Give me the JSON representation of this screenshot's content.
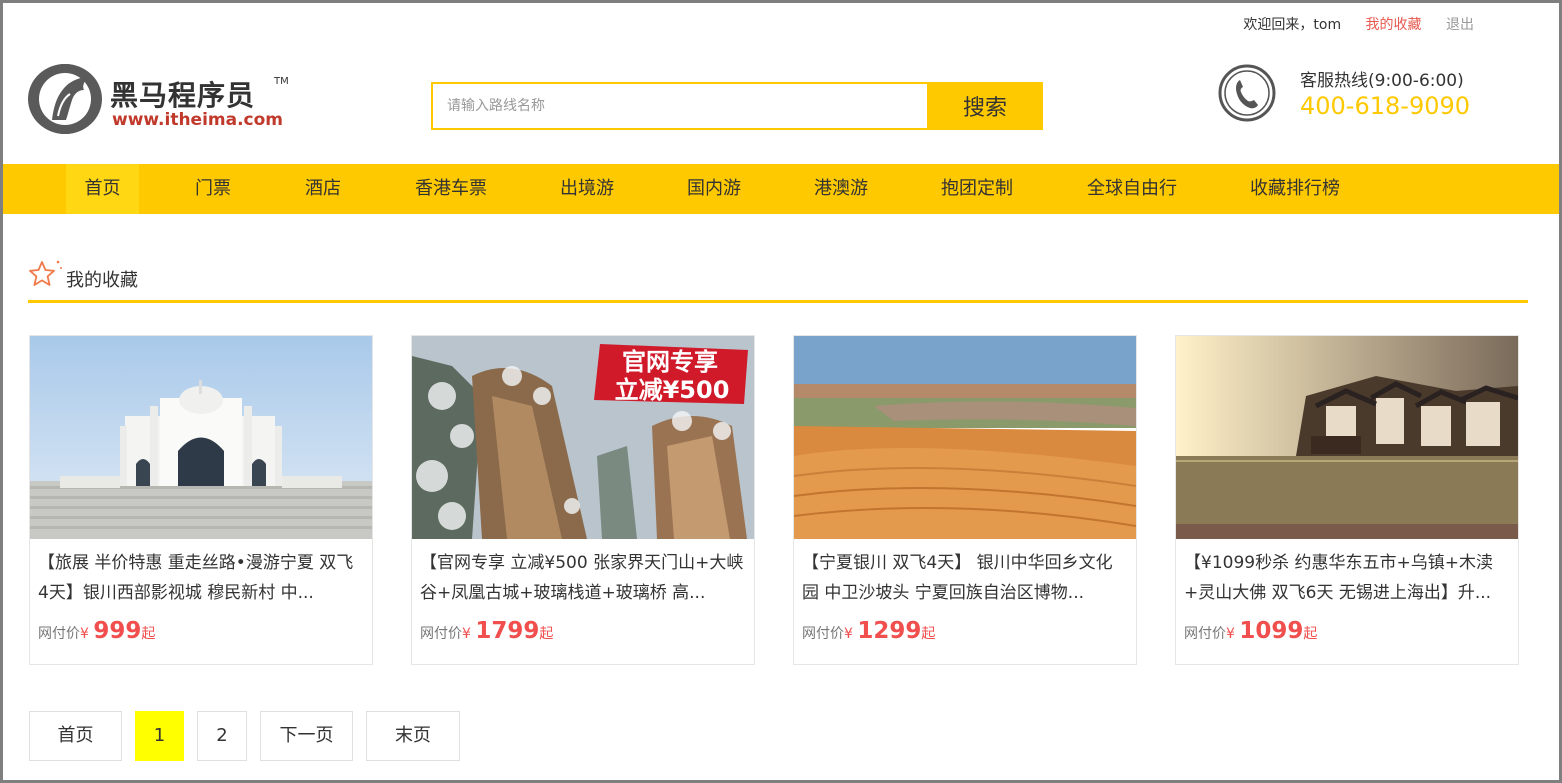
{
  "topbar": {
    "welcome": "欢迎回来，tom",
    "favorites": "我的收藏",
    "logout": "退出"
  },
  "logo": {
    "name": "黑马程序员",
    "tm": "TM",
    "url": "www.itheima.com"
  },
  "search": {
    "placeholder": "请输入路线名称",
    "button": "搜索"
  },
  "hotline": {
    "label": "客服热线(9:00-6:00)",
    "number": "400-618-9090"
  },
  "nav": {
    "items": [
      {
        "label": "首页",
        "active": true
      },
      {
        "label": "门票"
      },
      {
        "label": "酒店"
      },
      {
        "label": "香港车票"
      },
      {
        "label": "出境游"
      },
      {
        "label": "国内游"
      },
      {
        "label": "港澳游"
      },
      {
        "label": "抱团定制"
      },
      {
        "label": "全球自由行"
      },
      {
        "label": "收藏排行榜"
      }
    ]
  },
  "section": {
    "title": "我的收藏"
  },
  "cards": [
    {
      "title": "【旅展 半价特惠 重走丝路•漫游宁夏 双飞4天】银川西部影视城 穆民新村 中...",
      "price_label": "网付价",
      "currency": "¥",
      "price": "999",
      "suffix": "起"
    },
    {
      "title": "【官网专享 立减¥500 张家界天门山+大峡谷+凤凰古城+玻璃栈道+玻璃桥 高...",
      "price_label": "网付价",
      "currency": "¥",
      "price": "1799",
      "suffix": "起",
      "badge_line1": "官网专享",
      "badge_line2": "立减¥500"
    },
    {
      "title": "【宁夏银川 双飞4天】 银川中华回乡文化园 中卫沙坡头 宁夏回族自治区博物...",
      "price_label": "网付价",
      "currency": "¥",
      "price": "1299",
      "suffix": "起"
    },
    {
      "title": "【¥1099秒杀 约惠华东五市+乌镇+木渎+灵山大佛 双飞6天 无锡进上海出】升...",
      "price_label": "网付价",
      "currency": "¥",
      "price": "1099",
      "suffix": "起"
    }
  ],
  "pagination": {
    "first": "首页",
    "pages": [
      "1",
      "2"
    ],
    "current": "1",
    "next": "下一页",
    "last": "末页"
  },
  "colors": {
    "accent": "#ffc900",
    "price": "#f14e4e",
    "current_page": "#ffff00"
  }
}
